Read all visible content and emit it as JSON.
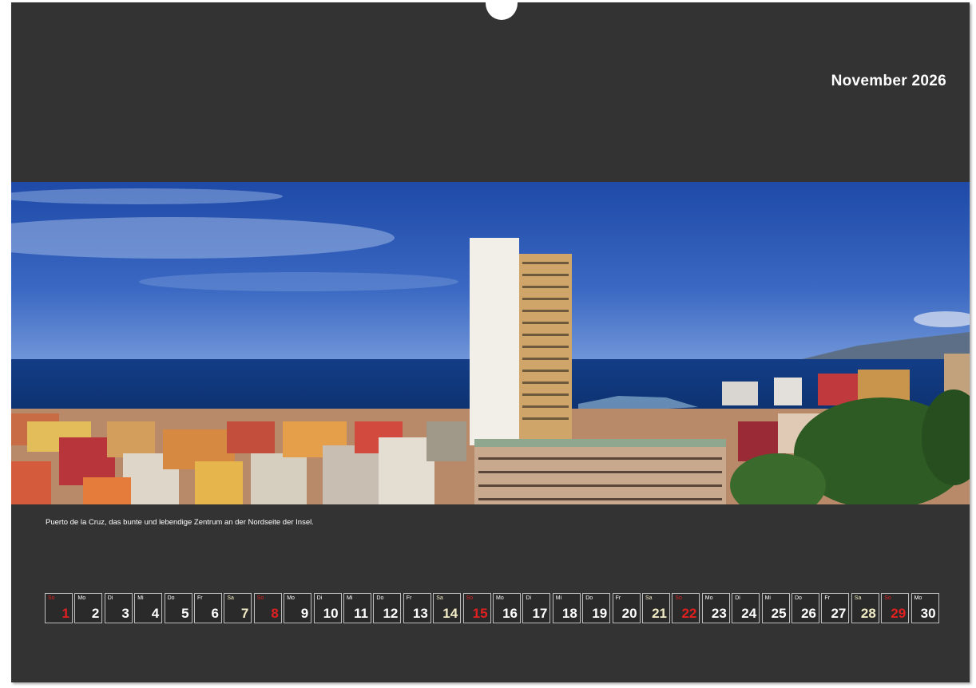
{
  "calendar": {
    "month_title": "November 2026",
    "caption": "Puerto de la Cruz, das bunte und lebendige Zentrum an der Nordseite der Insel.",
    "days": [
      {
        "wd": "So",
        "num": "1",
        "type": "sun"
      },
      {
        "wd": "Mo",
        "num": "2",
        "type": "week"
      },
      {
        "wd": "Di",
        "num": "3",
        "type": "week"
      },
      {
        "wd": "Mi",
        "num": "4",
        "type": "week"
      },
      {
        "wd": "Do",
        "num": "5",
        "type": "week"
      },
      {
        "wd": "Fr",
        "num": "6",
        "type": "week"
      },
      {
        "wd": "Sa",
        "num": "7",
        "type": "sat"
      },
      {
        "wd": "So",
        "num": "8",
        "type": "sun"
      },
      {
        "wd": "Mo",
        "num": "9",
        "type": "week"
      },
      {
        "wd": "Di",
        "num": "10",
        "type": "week"
      },
      {
        "wd": "Mi",
        "num": "11",
        "type": "week"
      },
      {
        "wd": "Do",
        "num": "12",
        "type": "week"
      },
      {
        "wd": "Fr",
        "num": "13",
        "type": "week"
      },
      {
        "wd": "Sa",
        "num": "14",
        "type": "sat"
      },
      {
        "wd": "So",
        "num": "15",
        "type": "sun"
      },
      {
        "wd": "Mo",
        "num": "16",
        "type": "week"
      },
      {
        "wd": "Di",
        "num": "17",
        "type": "week"
      },
      {
        "wd": "Mi",
        "num": "18",
        "type": "week"
      },
      {
        "wd": "Do",
        "num": "19",
        "type": "week"
      },
      {
        "wd": "Fr",
        "num": "20",
        "type": "week"
      },
      {
        "wd": "Sa",
        "num": "21",
        "type": "sat"
      },
      {
        "wd": "So",
        "num": "22",
        "type": "sun"
      },
      {
        "wd": "Mo",
        "num": "23",
        "type": "week"
      },
      {
        "wd": "Di",
        "num": "24",
        "type": "week"
      },
      {
        "wd": "Mi",
        "num": "25",
        "type": "week"
      },
      {
        "wd": "Do",
        "num": "26",
        "type": "week"
      },
      {
        "wd": "Fr",
        "num": "27",
        "type": "week"
      },
      {
        "wd": "Sa",
        "num": "28",
        "type": "sat"
      },
      {
        "wd": "So",
        "num": "29",
        "type": "sun"
      },
      {
        "wd": "Mo",
        "num": "30",
        "type": "week"
      }
    ]
  },
  "colors": {
    "page_background": "#333333",
    "sunday": "#e02020",
    "saturday": "#f1ecc6",
    "weekday": "#ffffff"
  },
  "photo": {
    "subject": "panorama-harbor-town-icon"
  }
}
